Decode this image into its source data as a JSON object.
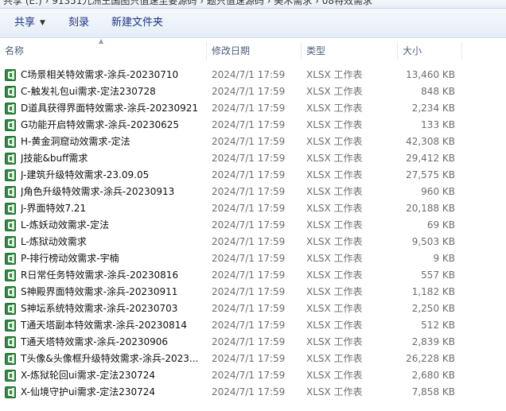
{
  "address": {
    "text": "共享 (E:)  ›  91351九洲王国图只值速至要源码  ›  题只值速源码  ›  美术需求  ›  08特效需求"
  },
  "toolbar": {
    "share_label": "共享",
    "burn_label": "刻录",
    "new_folder_label": "新建文件夹"
  },
  "columns": {
    "name": "名称",
    "date": "修改日期",
    "type": "类型",
    "size": "大小"
  },
  "files": [
    {
      "name": "C场景相关特效需求-涂兵-20230710",
      "date": "2024/7/1 17:59",
      "type": "XLSX 工作表",
      "size": "13,460 KB"
    },
    {
      "name": "C-触发礼包ui需求-定法230728",
      "date": "2024/7/1 17:59",
      "type": "XLSX 工作表",
      "size": "848 KB"
    },
    {
      "name": "D道具获得界面特效需求-涂兵-20230921",
      "date": "2024/7/1 17:59",
      "type": "XLSX 工作表",
      "size": "2,234 KB"
    },
    {
      "name": "G功能开启特效需求-涂兵-20230625",
      "date": "2024/7/1 17:59",
      "type": "XLSX 工作表",
      "size": "133 KB"
    },
    {
      "name": "H-黄金洞窟动效需求-定法",
      "date": "2024/7/1 17:59",
      "type": "XLSX 工作表",
      "size": "42,308 KB"
    },
    {
      "name": "J技能&buff需求",
      "date": "2024/7/1 17:59",
      "type": "XLSX 工作表",
      "size": "29,412 KB"
    },
    {
      "name": "J-建筑升级特效需求-23.09.05",
      "date": "2024/7/1 17:59",
      "type": "XLSX 工作表",
      "size": "27,575 KB"
    },
    {
      "name": "J角色升级特效需求-涂兵-20230913",
      "date": "2024/7/1 17:59",
      "type": "XLSX 工作表",
      "size": "960 KB"
    },
    {
      "name": "J-界面特效7.21",
      "date": "2024/7/1 17:59",
      "type": "XLSX 工作表",
      "size": "20,188 KB"
    },
    {
      "name": "L-炼妖动效需求-定法",
      "date": "2024/7/1 17:59",
      "type": "XLSX 工作表",
      "size": "69 KB"
    },
    {
      "name": "L-炼狱动效需求",
      "date": "2024/7/1 17:59",
      "type": "XLSX 工作表",
      "size": "9,503 KB"
    },
    {
      "name": "P-排行榜动效需求-宇楠",
      "date": "2024/7/1 17:59",
      "type": "XLSX 工作表",
      "size": "9 KB"
    },
    {
      "name": "R日常任务特效需求-涂兵-20230816",
      "date": "2024/7/1 17:59",
      "type": "XLSX 工作表",
      "size": "557 KB"
    },
    {
      "name": "S神殿界面特效需求-涂兵-20230911",
      "date": "2024/7/1 17:59",
      "type": "XLSX 工作表",
      "size": "1,182 KB"
    },
    {
      "name": "S神坛系统特效需求-涂兵-20230703",
      "date": "2024/7/1 17:59",
      "type": "XLSX 工作表",
      "size": "2,250 KB"
    },
    {
      "name": "T通天塔副本特效需求-涂兵-20230814",
      "date": "2024/7/1 17:59",
      "type": "XLSX 工作表",
      "size": "512 KB"
    },
    {
      "name": "T通天塔特效需求-涂兵-20230906",
      "date": "2024/7/1 17:59",
      "type": "XLSX 工作表",
      "size": "2,839 KB"
    },
    {
      "name": "T头像&头像框升级特效需求-涂兵-2023...",
      "date": "2024/7/1 17:59",
      "type": "XLSX 工作表",
      "size": "26,228 KB"
    },
    {
      "name": "X-炼狱轮回ui需求-定法230724",
      "date": "2024/7/1 17:59",
      "type": "XLSX 工作表",
      "size": "2,680 KB"
    },
    {
      "name": "X-仙境守护ui需求-定法230724",
      "date": "2024/7/1 17:59",
      "type": "XLSX 工作表",
      "size": "7,858 KB"
    }
  ]
}
